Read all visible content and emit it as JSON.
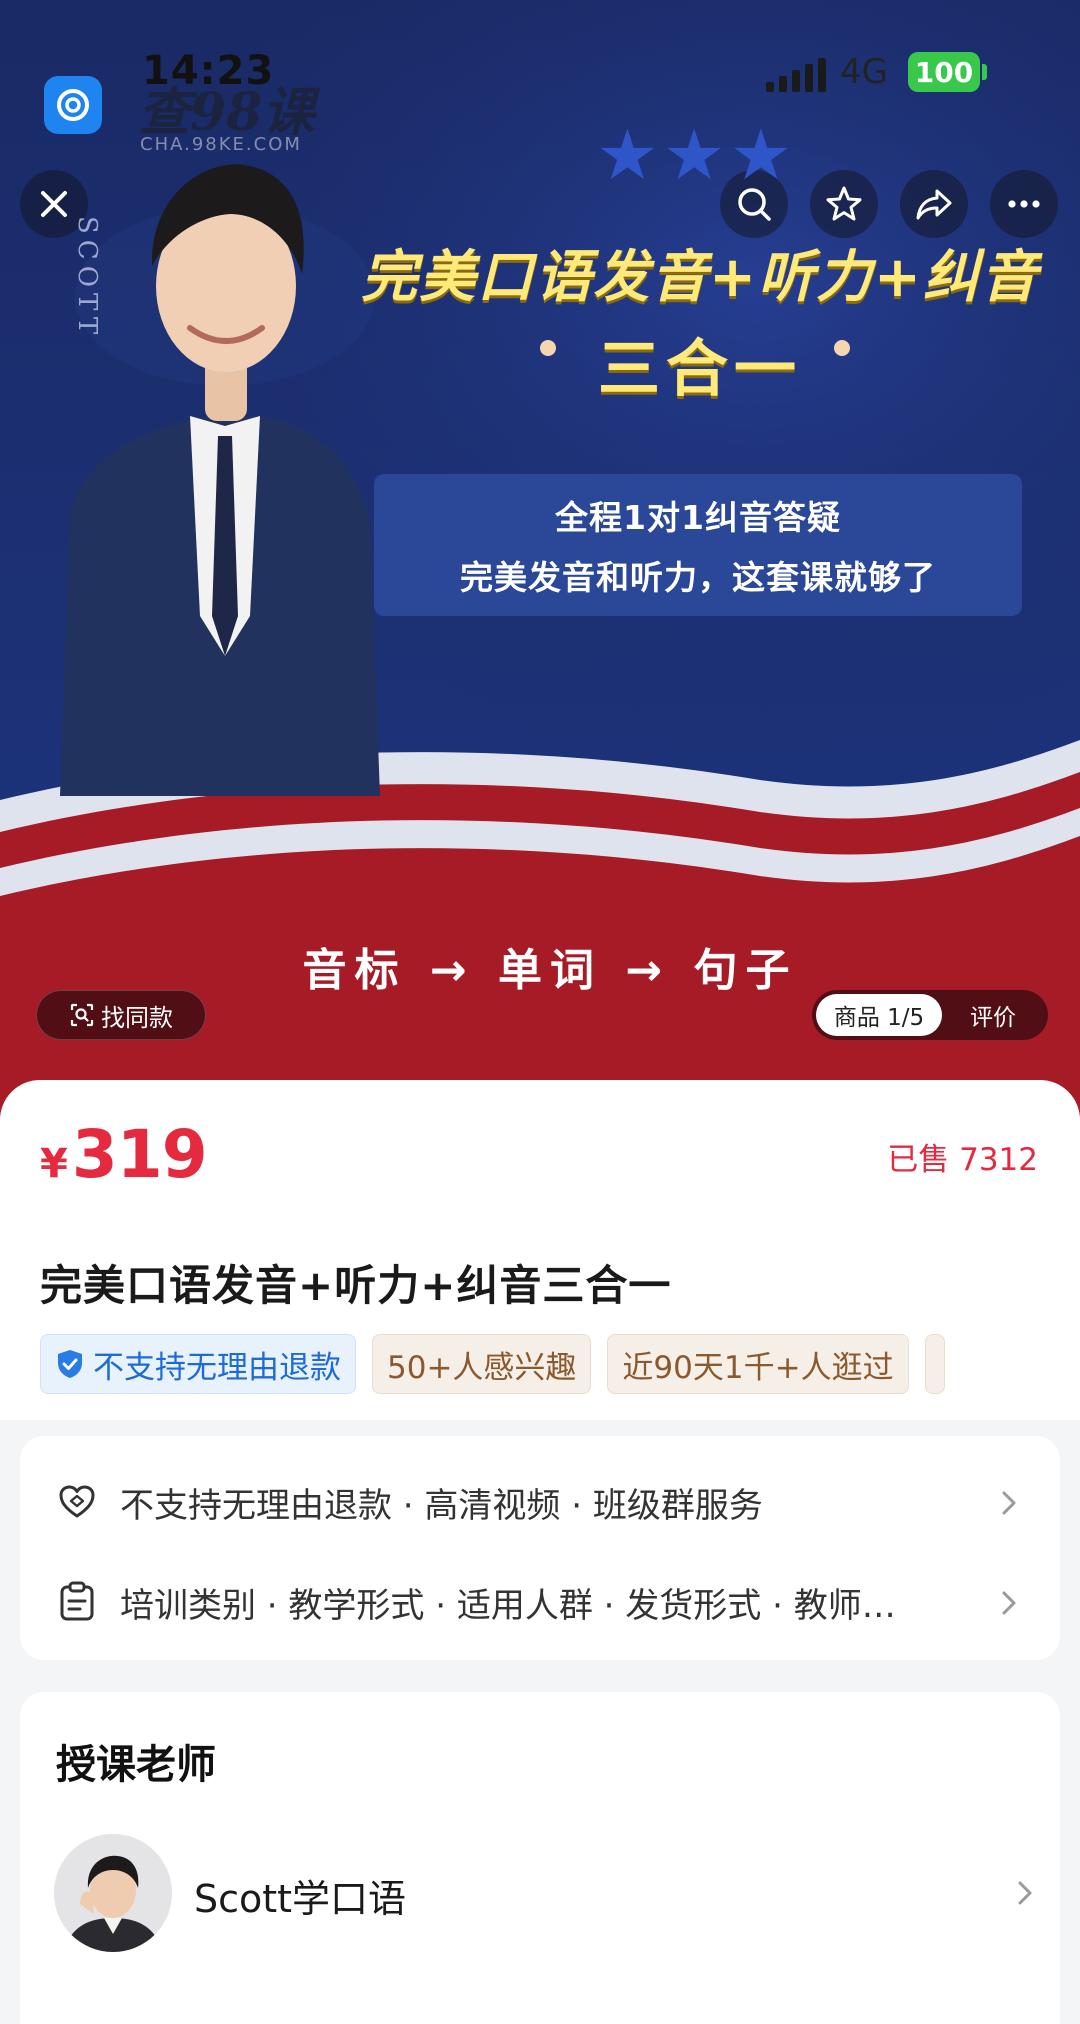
{
  "status_bar": {
    "time": "14:23",
    "network": "4G",
    "battery": "100"
  },
  "watermark": {
    "text": "查98课",
    "sub": "CHA.98KE.COM"
  },
  "banner": {
    "brand_vertical": "SCOTT",
    "stars": "★★★",
    "headline_line1": "完美口语发音+听力+纠音",
    "headline_line2": "三合一",
    "promo_line1": "全程1对1纠音答疑",
    "promo_line2": "完美发音和听力，这套课就够了",
    "slogan": "音标 → 单词 → 句子"
  },
  "hero_controls": {
    "find_same": "找同款",
    "tab_product": "商品 1/5",
    "tab_review": "评价"
  },
  "product": {
    "currency": "¥",
    "price": "319",
    "sold": "已售 7312",
    "title": "完美口语发音+听力+纠音三合一",
    "tags": [
      "不支持无理由退款",
      "50+人感兴趣",
      "近90天1千+人逛过"
    ]
  },
  "info_rows": [
    {
      "icon": "heart-shield-icon",
      "text": "不支持无理由退款 · 高清视频 · 班级群服务"
    },
    {
      "icon": "clipboard-icon",
      "text": "培训类别 · 教学形式 · 适用人群 · 发货形式 · 教师…"
    }
  ],
  "teacher": {
    "heading": "授课老师",
    "name": "Scott学口语"
  },
  "colors": {
    "price_red": "#e5293f",
    "banner_navy": "#1b2f73",
    "banner_red": "#a61b26",
    "headline_yellow": "#ffe979"
  }
}
